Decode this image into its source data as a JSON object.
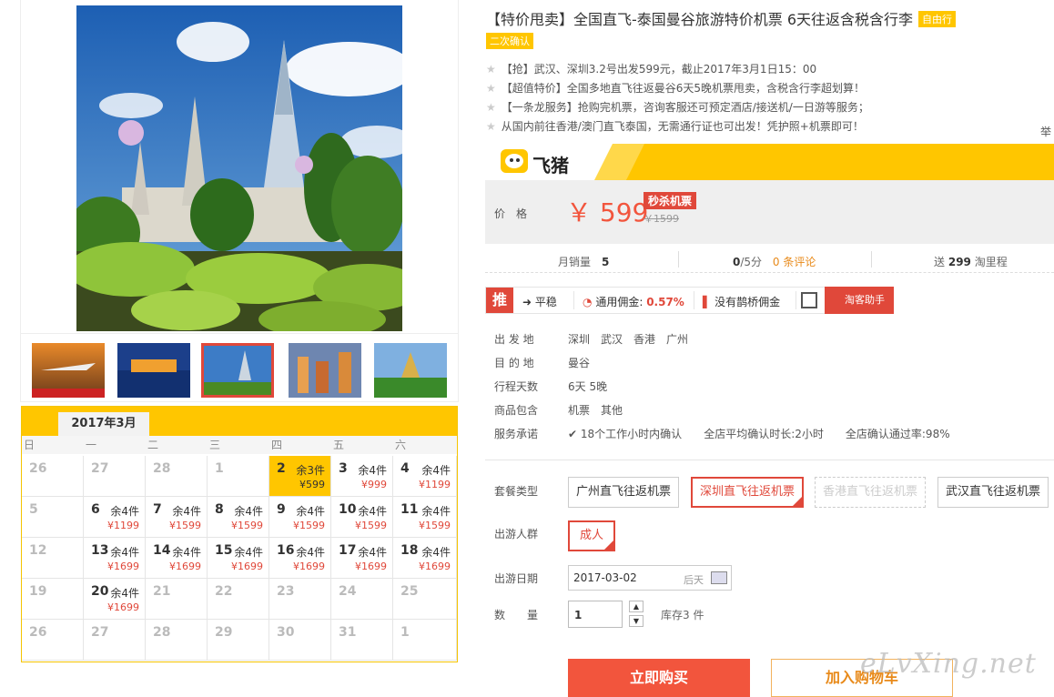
{
  "product": {
    "title": "【特价甩卖】全国直飞-泰国曼谷旅游特价机票 6天往返含税含行李",
    "tag_free": "自由行",
    "tag_confirm": "二次确认",
    "promos": [
      "【抢】武汉、深圳3.2号出发599元，截止2017年3月1日15：00",
      "【超值特价】全国多地直飞往返曼谷6天5晚机票甩卖，含税含行李超划算！",
      "【一条龙服务】抢购完机票，咨询客服还可预定酒店/接送机/一日游等服务；",
      "从国内前往香港/澳门直飞泰国，无需通行证也可出发！凭护照+机票即可！"
    ],
    "report_cut": "举"
  },
  "brand": {
    "name": "飞猪"
  },
  "price": {
    "label": "价　格",
    "current": "￥ 599",
    "badge": "秒杀机票",
    "original": "￥1599"
  },
  "stats": {
    "monthly_label": "月销量",
    "monthly_value": "5",
    "rating_value": "0",
    "rating_suffix": "/5分",
    "reviews": "0 条评论",
    "points_prefix": "送",
    "points_value": "299",
    "points_suffix": "淘里程"
  },
  "toolbar": {
    "tui": "推",
    "trend": "平稳",
    "commission_label": "通用佣金:",
    "commission_value": "0.57%",
    "bridge": "没有鹊桥佣金",
    "helper": "淘客助手"
  },
  "details": [
    {
      "label": "出 发 地",
      "value": "深圳　武汉　香港　广州"
    },
    {
      "label": "目 的 地",
      "value": "曼谷"
    },
    {
      "label": "行程天数",
      "value": "6天 5晚"
    },
    {
      "label": "商品包含",
      "value": "机票　其他"
    }
  ],
  "service": {
    "label": "服务承诺",
    "items": [
      "18个工作小时内确认",
      "全店平均确认时长:2小时",
      "全店确认通过率:98%"
    ]
  },
  "package": {
    "label": "套餐类型",
    "options": [
      "广州直飞往返机票",
      "深圳直飞往返机票",
      "香港直飞往返机票",
      "武汉直飞往返机票"
    ]
  },
  "travelers": {
    "label": "出游人群",
    "option": "成人"
  },
  "date": {
    "label": "出游日期",
    "value": "2017-03-02",
    "suffix": "后天"
  },
  "quantity": {
    "label": "数　　量",
    "value": "1",
    "stock": "库存3 件"
  },
  "actions": {
    "buy": "立即购买",
    "cart": "加入购物车"
  },
  "watermark": "eLvXing.net",
  "calendar": {
    "title": "2017年3月",
    "weekdays": [
      "日",
      "一",
      "二",
      "三",
      "四",
      "五",
      "六"
    ],
    "rows": [
      [
        {
          "d": "26",
          "g": true
        },
        {
          "d": "27",
          "g": true
        },
        {
          "d": "28",
          "g": true
        },
        {
          "d": "1",
          "g": true
        },
        {
          "d": "2",
          "s": "余3件",
          "p": "¥599",
          "today": true
        },
        {
          "d": "3",
          "s": "余4件",
          "p": "¥999"
        },
        {
          "d": "4",
          "s": "余4件",
          "p": "¥1199"
        }
      ],
      [
        {
          "d": "5",
          "g": true
        },
        {
          "d": "6",
          "s": "余4件",
          "p": "¥1199"
        },
        {
          "d": "7",
          "s": "余4件",
          "p": "¥1599"
        },
        {
          "d": "8",
          "s": "余4件",
          "p": "¥1599"
        },
        {
          "d": "9",
          "s": "余4件",
          "p": "¥1599"
        },
        {
          "d": "10",
          "s": "余4件",
          "p": "¥1599"
        },
        {
          "d": "11",
          "s": "余4件",
          "p": "¥1599"
        }
      ],
      [
        {
          "d": "12",
          "g": true
        },
        {
          "d": "13",
          "s": "余4件",
          "p": "¥1699"
        },
        {
          "d": "14",
          "s": "余4件",
          "p": "¥1699"
        },
        {
          "d": "15",
          "s": "余4件",
          "p": "¥1699"
        },
        {
          "d": "16",
          "s": "余4件",
          "p": "¥1699"
        },
        {
          "d": "17",
          "s": "余4件",
          "p": "¥1699"
        },
        {
          "d": "18",
          "s": "余4件",
          "p": "¥1699"
        }
      ],
      [
        {
          "d": "19",
          "g": true
        },
        {
          "d": "20",
          "s": "余4件",
          "p": "¥1699"
        },
        {
          "d": "21",
          "g": true
        },
        {
          "d": "22",
          "g": true
        },
        {
          "d": "23",
          "g": true
        },
        {
          "d": "24",
          "g": true
        },
        {
          "d": "25",
          "g": true
        }
      ],
      [
        {
          "d": "26",
          "g": true
        },
        {
          "d": "27",
          "g": true
        },
        {
          "d": "28",
          "g": true
        },
        {
          "d": "29",
          "g": true
        },
        {
          "d": "30",
          "g": true
        },
        {
          "d": "31",
          "g": true
        },
        {
          "d": "1",
          "g": true
        }
      ]
    ]
  }
}
